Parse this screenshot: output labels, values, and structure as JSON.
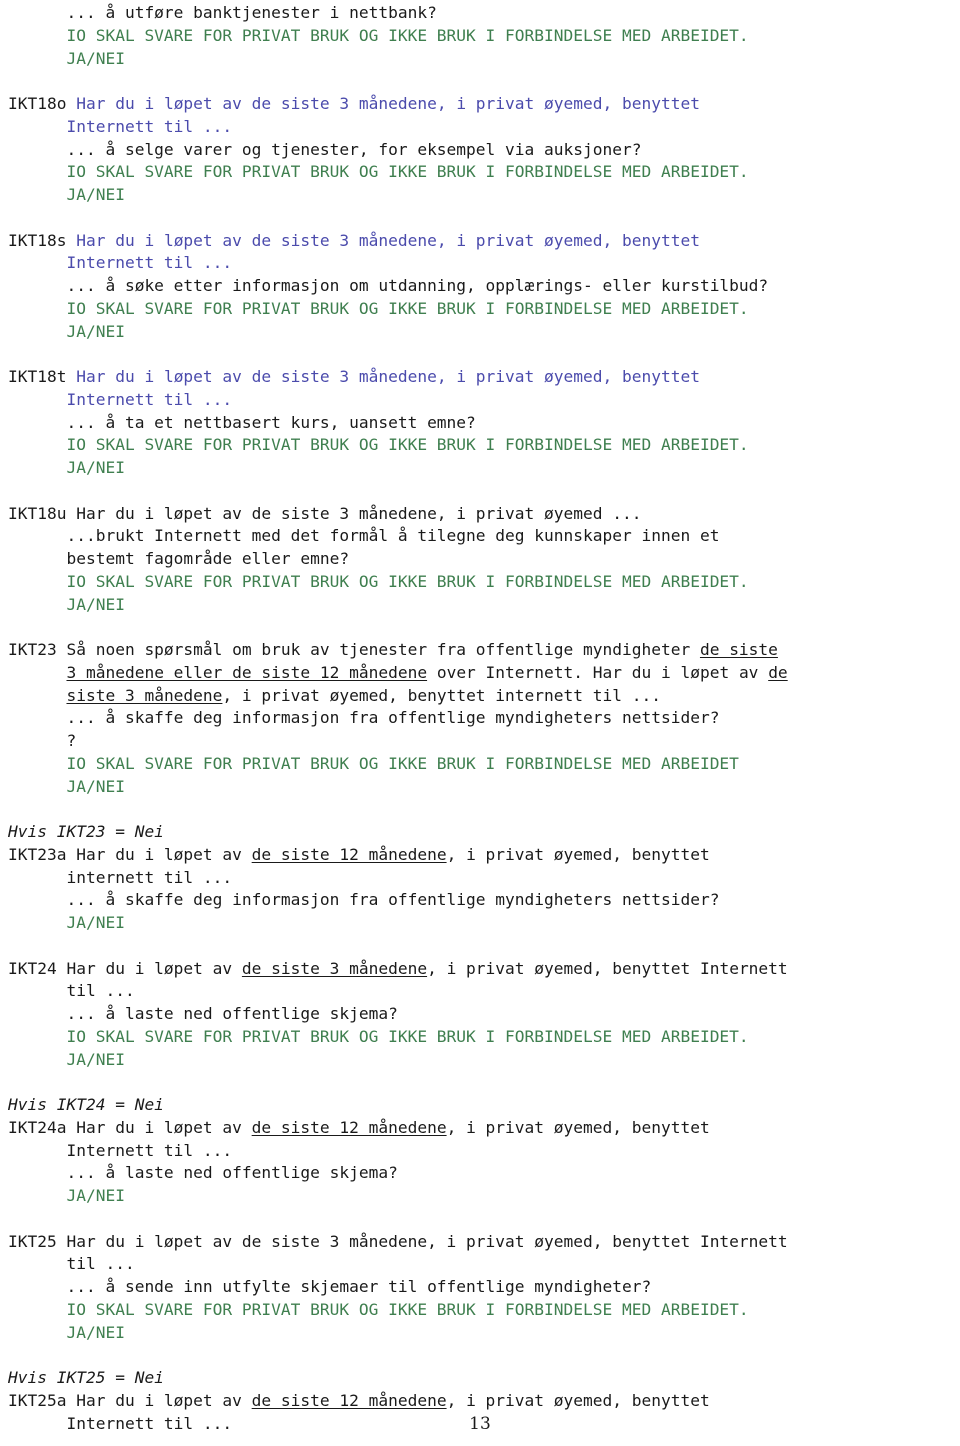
{
  "document": {
    "page_number": "13",
    "language": "no",
    "colors": {
      "text_black": "#1a1a1a",
      "text_blue": "#4b4bac",
      "text_green": "#3f7f4f",
      "background": "#ffffff"
    }
  },
  "lines": [
    {
      "id": "l01",
      "indent": 6,
      "color": "black",
      "text": "... å utføre banktjenester i nettbank?"
    },
    {
      "id": "l02",
      "indent": 6,
      "color": "green",
      "text": "IO SKAL SVARE FOR PRIVAT BRUK OG IKKE BRUK I FORBINDELSE MED ARBEIDET."
    },
    {
      "id": "l03",
      "indent": 6,
      "color": "green",
      "text": "JA/NEI"
    },
    {
      "id": "l04",
      "blank": true
    },
    {
      "id": "l05",
      "indent": 0,
      "color": "black",
      "code": "IKT18o",
      "text": "IKT18o ",
      "tail_color": "blue",
      "tail": "Har du i løpet av de siste 3 månedene, i privat øyemed, benyttet"
    },
    {
      "id": "l06",
      "indent": 6,
      "color": "blue",
      "text": "Internett til ..."
    },
    {
      "id": "l07",
      "indent": 6,
      "color": "black",
      "text": "... å selge varer og tjenester, for eksempel via auksjoner?"
    },
    {
      "id": "l08",
      "indent": 6,
      "color": "green",
      "text": "IO SKAL SVARE FOR PRIVAT BRUK OG IKKE BRUK I FORBINDELSE MED ARBEIDET."
    },
    {
      "id": "l09",
      "indent": 6,
      "color": "green",
      "text": "JA/NEI"
    },
    {
      "id": "l10",
      "blank": true
    },
    {
      "id": "l11",
      "indent": 0,
      "color": "black",
      "code": "IKT18s",
      "text": "IKT18s ",
      "tail_color": "blue",
      "tail": "Har du i løpet av de siste 3 månedene, i privat øyemed, benyttet"
    },
    {
      "id": "l12",
      "indent": 6,
      "color": "blue",
      "text": "Internett til ..."
    },
    {
      "id": "l13",
      "indent": 6,
      "color": "black",
      "text": "... å søke etter informasjon om utdanning, opplærings- eller kurstilbud?"
    },
    {
      "id": "l14",
      "indent": 6,
      "color": "green",
      "text": "IO SKAL SVARE FOR PRIVAT BRUK OG IKKE BRUK I FORBINDELSE MED ARBEIDET."
    },
    {
      "id": "l15",
      "indent": 6,
      "color": "green",
      "text": "JA/NEI"
    },
    {
      "id": "l16",
      "blank": true
    },
    {
      "id": "l17",
      "indent": 0,
      "color": "black",
      "code": "IKT18t",
      "text": "IKT18t ",
      "tail_color": "blue",
      "tail": "Har du i løpet av de siste 3 månedene, i privat øyemed, benyttet"
    },
    {
      "id": "l18",
      "indent": 6,
      "color": "blue",
      "text": "Internett til ..."
    },
    {
      "id": "l19",
      "indent": 6,
      "color": "black",
      "text": "... å ta et nettbasert kurs, uansett emne?"
    },
    {
      "id": "l20",
      "indent": 6,
      "color": "green",
      "text": "IO SKAL SVARE FOR PRIVAT BRUK OG IKKE BRUK I FORBINDELSE MED ARBEIDET."
    },
    {
      "id": "l21",
      "indent": 6,
      "color": "green",
      "text": "JA/NEI"
    },
    {
      "id": "l22",
      "blank": true
    },
    {
      "id": "l23",
      "indent": 0,
      "color": "black",
      "text": "IKT18u Har du i løpet av de siste 3 månedene, i privat øyemed ..."
    },
    {
      "id": "l24",
      "indent": 6,
      "color": "black",
      "text": "...brukt Internett med det formål å tilegne deg kunnskaper innen et"
    },
    {
      "id": "l25",
      "indent": 6,
      "color": "black",
      "text": "bestemt fagområde eller emne?"
    },
    {
      "id": "l26",
      "indent": 6,
      "color": "green",
      "text": "IO SKAL SVARE FOR PRIVAT BRUK OG IKKE BRUK I FORBINDELSE MED ARBEIDET."
    },
    {
      "id": "l27",
      "indent": 6,
      "color": "green",
      "text": "JA/NEI"
    },
    {
      "id": "l28",
      "blank": true
    },
    {
      "id": "l29",
      "indent": 0,
      "color": "black",
      "text": "IKT23 Så noen spørsmål om bruk av tjenester fra offentlige myndigheter de siste",
      "underline_from": 71
    },
    {
      "id": "l30",
      "indent": 6,
      "color": "black",
      "text": "3 månedene eller de siste 12 månedene over Internett. Har du i løpet av de",
      "underline_to": 31,
      "underline_tail_from": 71
    },
    {
      "id": "l31",
      "indent": 6,
      "color": "black",
      "text": "siste 3 månedene, i privat øyemed, benyttet internett til ...",
      "underline_to": 17
    },
    {
      "id": "l32",
      "indent": 6,
      "color": "black",
      "text": "... å skaffe deg informasjon fra offentlige myndigheters nettsider?"
    },
    {
      "id": "l33",
      "indent": 6,
      "color": "black",
      "text": "?"
    },
    {
      "id": "l34",
      "indent": 6,
      "color": "green",
      "text": "IO SKAL SVARE FOR PRIVAT BRUK OG IKKE BRUK I FORBINDELSE MED ARBEIDET"
    },
    {
      "id": "l35",
      "indent": 6,
      "color": "green",
      "text": "JA/NEI"
    },
    {
      "id": "l36",
      "blank": true
    },
    {
      "id": "l37",
      "indent": 0,
      "color": "black",
      "italic": true,
      "text": "Hvis IKT23 = Nei"
    },
    {
      "id": "l38",
      "indent": 0,
      "color": "black",
      "text": "IKT23a Har du i løpet av de siste 12 månedene, i privat øyemed, benyttet",
      "underline_from": 26,
      "underline_len": 21
    },
    {
      "id": "l39",
      "indent": 6,
      "color": "black",
      "text": "internett til ..."
    },
    {
      "id": "l40",
      "indent": 6,
      "color": "black",
      "text": "... å skaffe deg informasjon fra offentlige myndigheters nettsider?"
    },
    {
      "id": "l41",
      "indent": 6,
      "color": "green",
      "text": "JA/NEI"
    },
    {
      "id": "l42",
      "blank": true
    },
    {
      "id": "l43",
      "indent": 0,
      "color": "black",
      "text": "IKT24 Har du i løpet av de siste 3 månedene, i privat øyemed, benyttet Internett",
      "underline_from": 25,
      "underline_len": 20
    },
    {
      "id": "l44",
      "indent": 6,
      "color": "black",
      "text": "til ..."
    },
    {
      "id": "l45",
      "indent": 6,
      "color": "black",
      "text": "... å laste ned offentlige skjema?"
    },
    {
      "id": "l46",
      "indent": 6,
      "color": "green",
      "text": "IO SKAL SVARE FOR PRIVAT BRUK OG IKKE BRUK I FORBINDELSE MED ARBEIDET."
    },
    {
      "id": "l47",
      "indent": 6,
      "color": "green",
      "text": "JA/NEI"
    },
    {
      "id": "l48",
      "blank": true
    },
    {
      "id": "l49",
      "indent": 0,
      "color": "black",
      "italic": true,
      "text": "Hvis IKT24 = Nei"
    },
    {
      "id": "l50",
      "indent": 0,
      "color": "black",
      "text": "IKT24a Har du i løpet av de siste 12 månedene, i privat øyemed, benyttet",
      "underline_from": 26,
      "underline_len": 21
    },
    {
      "id": "l51",
      "indent": 6,
      "color": "black",
      "text": "Internett til ..."
    },
    {
      "id": "l52",
      "indent": 6,
      "color": "black",
      "text": "... å laste ned offentlige skjema?"
    },
    {
      "id": "l53",
      "indent": 6,
      "color": "green",
      "text": "JA/NEI"
    },
    {
      "id": "l54",
      "blank": true
    },
    {
      "id": "l55",
      "indent": 0,
      "color": "black",
      "text": "IKT25 Har du i løpet av de siste 3 månedene, i privat øyemed, benyttet Internett"
    },
    {
      "id": "l56",
      "indent": 6,
      "color": "black",
      "text": "til ..."
    },
    {
      "id": "l57",
      "indent": 6,
      "color": "black",
      "text": "... å sende inn utfylte skjemaer til offentlige myndigheter?"
    },
    {
      "id": "l58",
      "indent": 6,
      "color": "green",
      "text": "IO SKAL SVARE FOR PRIVAT BRUK OG IKKE BRUK I FORBINDELSE MED ARBEIDET."
    },
    {
      "id": "l59",
      "indent": 6,
      "color": "green",
      "text": "JA/NEI"
    },
    {
      "id": "l60",
      "blank": true
    },
    {
      "id": "l61",
      "indent": 0,
      "color": "black",
      "italic": true,
      "text": "Hvis IKT25 = Nei"
    },
    {
      "id": "l62",
      "indent": 0,
      "color": "black",
      "text": "IKT25a Har du i løpet av de siste 12 månedene, i privat øyemed, benyttet",
      "underline_from": 26,
      "underline_len": 21
    },
    {
      "id": "l63",
      "indent": 6,
      "color": "black",
      "text": "Internett til ..."
    }
  ],
  "segments": {
    "l05": [
      {
        "t": "IKT18o ",
        "c": "black"
      },
      {
        "t": "Har du i løpet av de siste 3 månedene, i privat øyemed, benyttet",
        "c": "blue"
      }
    ],
    "l11": [
      {
        "t": "IKT18s ",
        "c": "black"
      },
      {
        "t": "Har du i løpet av de siste 3 månedene, i privat øyemed, benyttet",
        "c": "blue"
      }
    ],
    "l17": [
      {
        "t": "IKT18t ",
        "c": "black"
      },
      {
        "t": "Har du i løpet av de siste 3 månedene, i privat øyemed, benyttet",
        "c": "blue"
      }
    ],
    "l29": [
      {
        "t": "IKT23 Så noen spørsmål om bruk av tjenester fra offentlige myndigheter ",
        "c": "black"
      },
      {
        "t": "de siste",
        "c": "black",
        "u": true
      }
    ],
    "l30": [
      {
        "t": "3 månedene eller de siste 12 månedene",
        "c": "black",
        "u": true
      },
      {
        "t": " over Internett. Har du i løpet av ",
        "c": "black"
      },
      {
        "t": "de",
        "c": "black",
        "u": true
      }
    ],
    "l31": [
      {
        "t": "siste 3 månedene",
        "c": "black",
        "u": true
      },
      {
        "t": ", i privat øyemed, benyttet internett til ...",
        "c": "black"
      }
    ],
    "l38": [
      {
        "t": "IKT23a Har du i løpet av ",
        "c": "black"
      },
      {
        "t": "de siste 12 månedene",
        "c": "black",
        "u": true
      },
      {
        "t": ", i privat øyemed, benyttet",
        "c": "black"
      }
    ],
    "l43": [
      {
        "t": "IKT24 Har du i løpet av ",
        "c": "black"
      },
      {
        "t": "de siste 3 månedene",
        "c": "black",
        "u": true
      },
      {
        "t": ", i privat øyemed, benyttet Internett",
        "c": "black"
      }
    ],
    "l50": [
      {
        "t": "IKT24a Har du i løpet av ",
        "c": "black"
      },
      {
        "t": "de siste 12 månedene",
        "c": "black",
        "u": true
      },
      {
        "t": ", i privat øyemed, benyttet",
        "c": "black"
      }
    ],
    "l62": [
      {
        "t": "IKT25a Har du i løpet av ",
        "c": "black"
      },
      {
        "t": "de siste 12 månedene",
        "c": "black",
        "u": true
      },
      {
        "t": ", i privat øyemed, benyttet",
        "c": "black"
      }
    ]
  }
}
